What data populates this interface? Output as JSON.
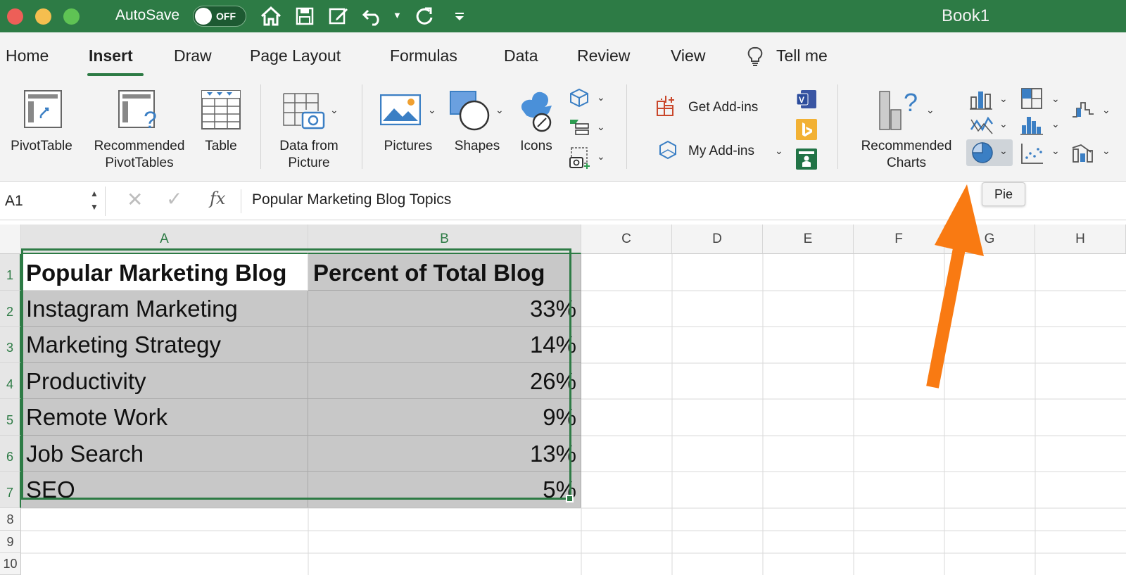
{
  "window": {
    "title": "Book1",
    "autosave_label": "AutoSave",
    "autosave_state": "OFF"
  },
  "tabs": [
    {
      "label": "Home"
    },
    {
      "label": "Insert"
    },
    {
      "label": "Draw"
    },
    {
      "label": "Page Layout"
    },
    {
      "label": "Formulas"
    },
    {
      "label": "Data"
    },
    {
      "label": "Review"
    },
    {
      "label": "View"
    },
    {
      "label": "Tell me"
    }
  ],
  "active_tab": "Insert",
  "ribbon": {
    "pivottable": "PivotTable",
    "recommended_pivot_1": "Recommended",
    "recommended_pivot_2": "PivotTables",
    "table": "Table",
    "data_from_picture_1": "Data from",
    "data_from_picture_2": "Picture",
    "pictures": "Pictures",
    "shapes": "Shapes",
    "icons": "Icons",
    "get_addins": "Get Add-ins",
    "my_addins": "My Add-ins",
    "recommended_charts_1": "Recommended",
    "recommended_charts_2": "Charts"
  },
  "tooltip": "Pie",
  "formula_bar": {
    "name_box": "A1",
    "fx": "fx",
    "content": "Popular Marketing Blog Topics"
  },
  "columns": [
    "A",
    "B",
    "C",
    "D",
    "E",
    "F",
    "G",
    "H"
  ],
  "rows": [
    "1",
    "2",
    "3",
    "4",
    "5",
    "6",
    "7",
    "8",
    "9",
    "10"
  ],
  "sheet": {
    "header": [
      "Popular Marketing Blog",
      "Percent of Total Blog"
    ],
    "data": [
      [
        "Instagram Marketing",
        "33%"
      ],
      [
        "Marketing Strategy",
        "14%"
      ],
      [
        "Productivity",
        "26%"
      ],
      [
        "Remote Work",
        "9%"
      ],
      [
        "Job Search",
        "13%"
      ],
      [
        "SEO",
        "5%"
      ]
    ]
  },
  "colors": {
    "accent": "#2d7b45",
    "annotation_arrow": "#f97a12",
    "selection_fill": "#c8c8c8"
  }
}
